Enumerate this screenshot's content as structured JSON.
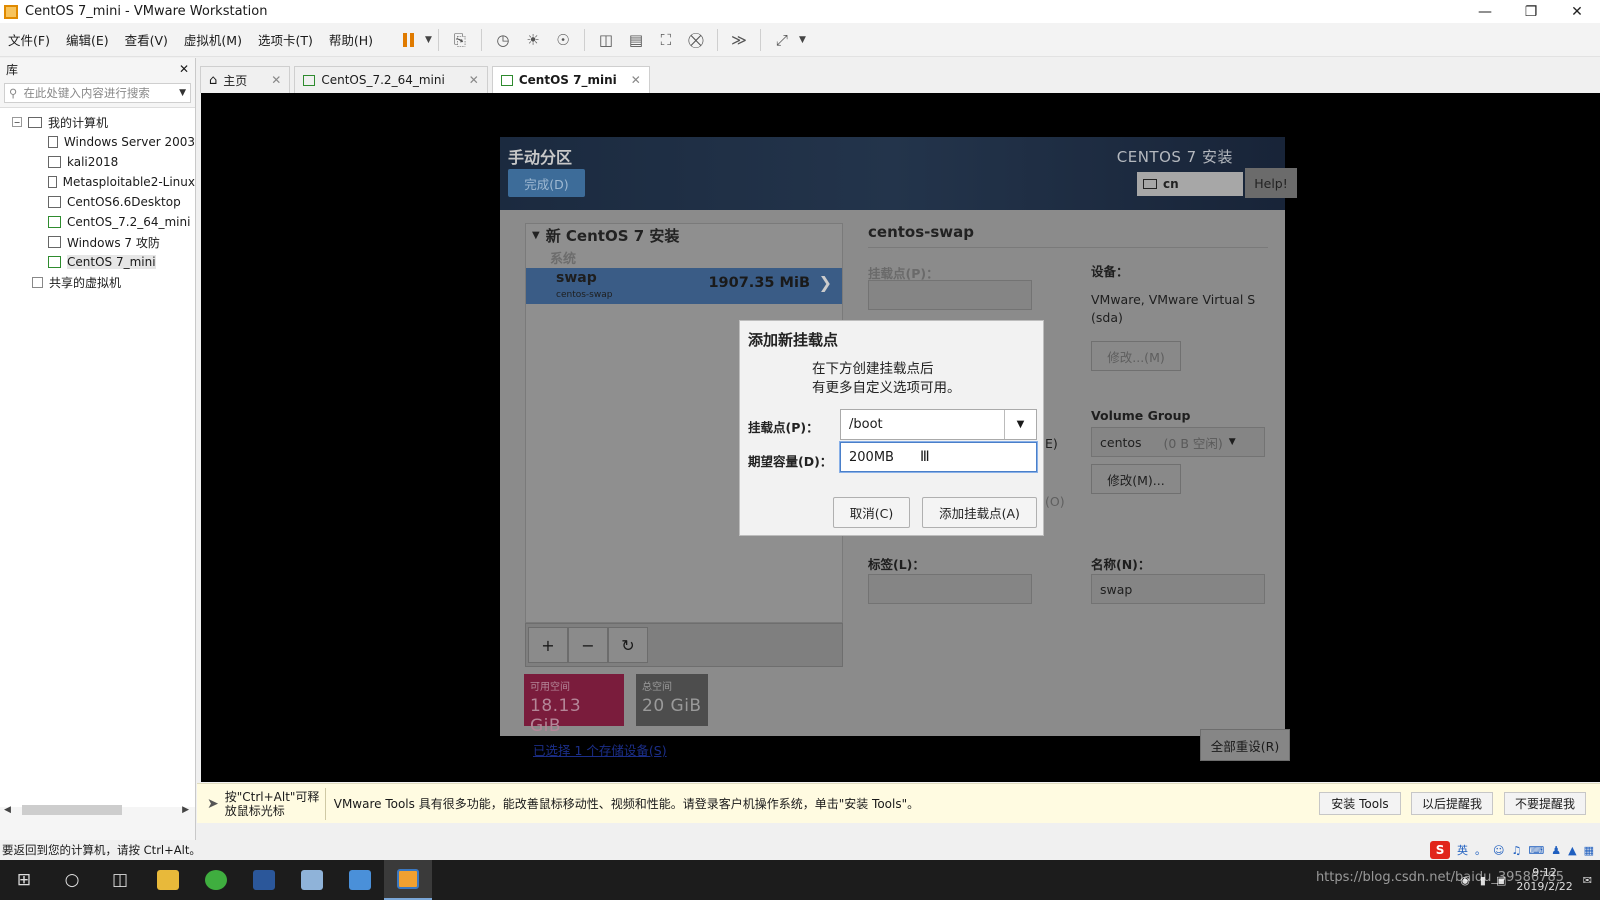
{
  "window": {
    "title": "CentOS 7_mini - VMware Workstation"
  },
  "menu": [
    "文件(F)",
    "编辑(E)",
    "查看(V)",
    "虚拟机(M)",
    "选项卡(T)",
    "帮助(H)"
  ],
  "library": {
    "title": "库",
    "search_placeholder": "在此处键入内容进行搜索",
    "root": "我的计算机",
    "vms": [
      "Windows Server 2003",
      "kali2018",
      "Metasploitable2-Linux",
      "CentOS6.6Desktop",
      "CentOS_7.2_64_mini",
      "Windows 7 攻防",
      "CentOS 7_mini"
    ],
    "shared": "共享的虚拟机"
  },
  "tabs": [
    "主页",
    "CentOS_7.2_64_mini",
    "CentOS 7_mini"
  ],
  "installer": {
    "header_title": "手动分区",
    "done_button": "完成(D)",
    "product_title": "CENTOS 7 安装",
    "keyboard": "cn",
    "help_button": "Help!",
    "section_title": "新 CentOS 7 安装",
    "system_label": "系统",
    "partition": {
      "name": "swap",
      "sub": "centos-swap",
      "size": "1907.35 MiB"
    },
    "available_label": "可用空间",
    "available_value": "18.13 GiB",
    "total_label": "总空间",
    "total_value": "20 GiB",
    "storage_link": "已选择 1 个存储设备(S)",
    "reset_button": "全部重设(R)",
    "details": {
      "title": "centos-swap",
      "mount_label": "挂载点(P)：",
      "device_label": "设备：",
      "device_value": "VMware, VMware Virtual S (sda)",
      "modify_button": "修改...(M)",
      "vg_label": "Volume Group",
      "vg_name": "centos",
      "vg_free": "(0 B 空闲)",
      "vg_modify_button": "修改(M)...",
      "partial_e": "E)",
      "partial_o": "(O)",
      "tag_label": "标签(L)：",
      "name_label": "名称(N)：",
      "name_value": "swap"
    }
  },
  "dialog": {
    "title": "添加新挂载点",
    "desc_line1": "在下方创建挂载点后",
    "desc_line2": "有更多自定义选项可用。",
    "mount_label": "挂载点(P)：",
    "mount_value": "/boot",
    "capacity_label": "期望容量(D)：",
    "capacity_value": "200MB",
    "cancel_button": "取消(C)",
    "add_button": "添加挂载点(A)"
  },
  "tools_bar": {
    "hint": "按\"Ctrl+Alt\"可释放鼠标光标",
    "message": "VMware Tools 具有很多功能，能改善鼠标移动性、视频和性能。请登录客户机操作系统，单击\"安装 Tools\"。",
    "install_button": "安装 Tools",
    "remind_button": "以后提醒我",
    "never_button": "不要提醒我"
  },
  "status": "要返回到您的计算机，请按 Ctrl+Alt。",
  "tray": {
    "time": "9:12",
    "date": "2019/2/22",
    "ime_lang": "英"
  },
  "watermark": "https://blog.csdn.net/baidu_39586785"
}
